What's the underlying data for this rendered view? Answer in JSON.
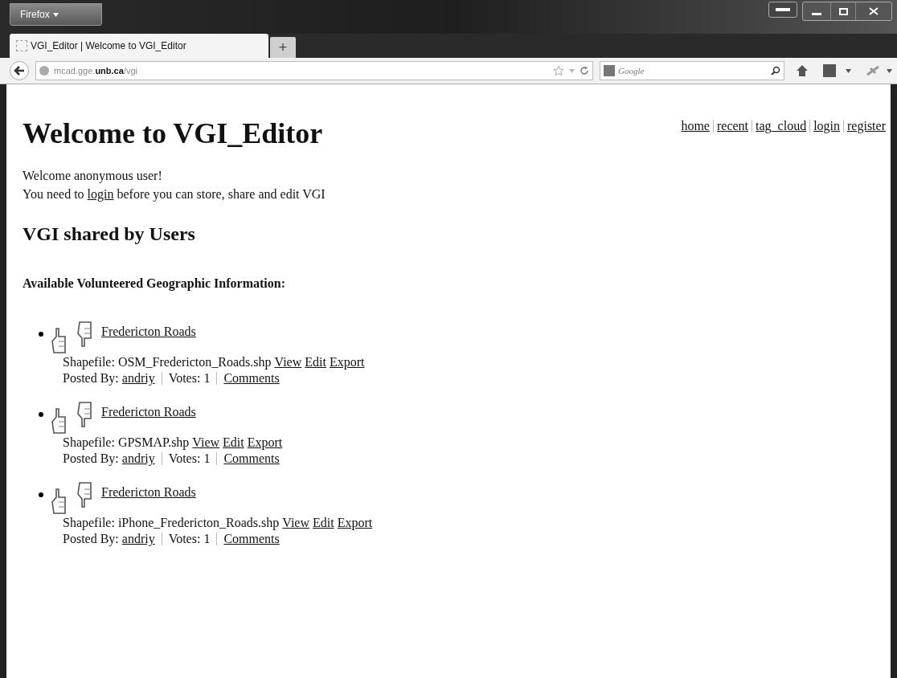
{
  "browser": {
    "menu_button": "Firefox",
    "tab": {
      "title": "VGI_Editor | Welcome to VGI_Editor",
      "selected": true
    },
    "new_tab": "+",
    "url": "mcad.gge.**unb.ca**/vgi",
    "search": {
      "placeholder": "Google"
    }
  },
  "page": {
    "title": "Welcome to VGI_Editor",
    "nav": [
      "home",
      "recent",
      "tag_cloud",
      "login",
      "register"
    ],
    "greeting": "Welcome anonymous user!",
    "notice": {
      "before": "You need to",
      "link": "login",
      "after": "before you can store, share and edit VGI"
    },
    "section_title": "VGI shared by Users",
    "list_title": "Available Volunteered Geographic Information:",
    "items": [
      {
        "title": "Fredericton Roads",
        "shapefile_label": "Shapefile:",
        "file": "OSM_Fredericton_Roads.shp",
        "actions": [
          "View",
          "Edit",
          "Export"
        ],
        "posted_label": "Posted By:",
        "author": "andriy",
        "votes": "Votes: 1",
        "comments": "Comments"
      },
      {
        "title": "Fredericton Roads",
        "shapefile_label": "Shapefile:",
        "file": "GPSMAP.shp",
        "actions": [
          "View",
          "Edit",
          "Export"
        ],
        "posted_label": "Posted By:",
        "author": "andriy",
        "votes": "Votes: 1",
        "comments": "Comments"
      },
      {
        "title": "Fredericton Roads",
        "shapefile_label": "Shapefile:",
        "file": "iPhone_Fredericton_Roads.shp",
        "actions": [
          "View",
          "Edit",
          "Export"
        ],
        "posted_label": "Posted By:",
        "author": "andriy",
        "votes": "Votes: 1",
        "comments": "Comments"
      }
    ]
  }
}
